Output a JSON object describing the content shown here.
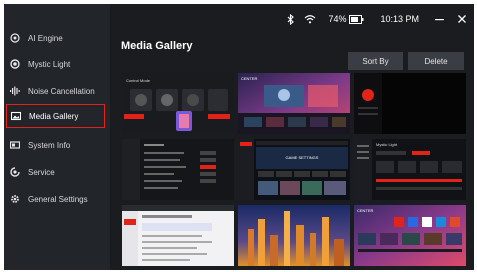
{
  "status": {
    "battery": "74%",
    "time": "10:13 PM"
  },
  "sidebar": {
    "items": [
      {
        "label": "AI Engine",
        "icon": "ai-engine-icon"
      },
      {
        "label": "Mystic Light",
        "icon": "mystic-light-icon"
      },
      {
        "label": "Noise Cancellation",
        "icon": "noise-cancellation-icon"
      },
      {
        "label": "Media Gallery",
        "icon": "media-gallery-icon",
        "active": true
      },
      {
        "label": "System Info",
        "icon": "system-info-icon"
      },
      {
        "label": "Service",
        "icon": "service-icon"
      },
      {
        "label": "General Settings",
        "icon": "general-settings-icon"
      }
    ]
  },
  "main": {
    "title": "Media Gallery",
    "sort_label": "Sort By",
    "delete_label": "Delete"
  },
  "gallery": {
    "thumbnails": [
      {
        "name": "screenshot-control-mode"
      },
      {
        "name": "screenshot-center-home"
      },
      {
        "name": "screenshot-black"
      },
      {
        "name": "screenshot-settings-list"
      },
      {
        "name": "screenshot-game-settings"
      },
      {
        "name": "screenshot-mystic-light"
      },
      {
        "name": "screenshot-web-page"
      },
      {
        "name": "screenshot-city-photo"
      },
      {
        "name": "screenshot-center-grid"
      }
    ],
    "texts": {
      "thumb1_title": "Control Mode",
      "thumb2_logo": "CENTER",
      "thumb5_header": "GAME SETTINGS",
      "thumb6_header": "Mystic Light",
      "thumb9_logo": "CENTER"
    }
  },
  "colors": {
    "accent": "#e2231a",
    "sidebar_bg": "#22252a",
    "main_bg": "#1a1c20"
  }
}
